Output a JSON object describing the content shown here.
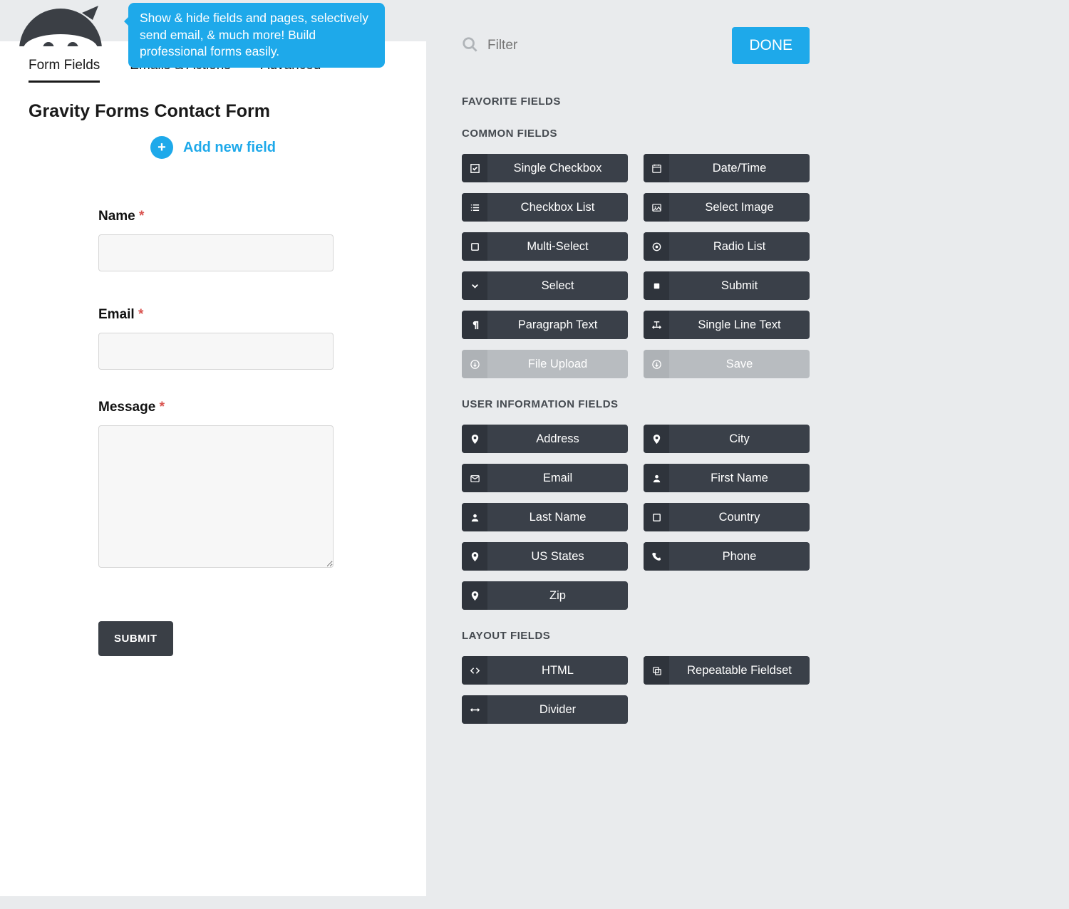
{
  "tooltip": "Show & hide fields and pages, selectively send email, & much more! Build professional forms easily.",
  "tabs": {
    "form_fields": "Form Fields",
    "emails_actions": "Emails & Actions",
    "advanced": "Advanced"
  },
  "form_title": "Gravity Forms Contact Form",
  "add_new_field": "Add new field",
  "fields": {
    "name": {
      "label": "Name",
      "required": true
    },
    "email": {
      "label": "Email",
      "required": true
    },
    "message": {
      "label": "Message",
      "required": true
    }
  },
  "submit_label": "SUBMIT",
  "filter_placeholder": "Filter",
  "done_label": "DONE",
  "sections": {
    "favorite": "FAVORITE FIELDS",
    "common": "COMMON FIELDS",
    "user": "USER INFORMATION FIELDS",
    "layout": "LAYOUT FIELDS"
  },
  "common_fields": [
    {
      "label": "Single Checkbox",
      "icon": "check-square"
    },
    {
      "label": "Date/Time",
      "icon": "calendar"
    },
    {
      "label": "Checkbox List",
      "icon": "list"
    },
    {
      "label": "Select Image",
      "icon": "image"
    },
    {
      "label": "Multi-Select",
      "icon": "square"
    },
    {
      "label": "Radio List",
      "icon": "dot-circle"
    },
    {
      "label": "Select",
      "icon": "chevron-down"
    },
    {
      "label": "Submit",
      "icon": "square-filled"
    },
    {
      "label": "Paragraph Text",
      "icon": "paragraph"
    },
    {
      "label": "Single Line Text",
      "icon": "text-width"
    },
    {
      "label": "File Upload",
      "icon": "circle-arrow",
      "disabled": true
    },
    {
      "label": "Save",
      "icon": "circle-arrow",
      "disabled": true
    }
  ],
  "user_fields": [
    {
      "label": "Address",
      "icon": "map-marker"
    },
    {
      "label": "City",
      "icon": "map-marker"
    },
    {
      "label": "Email",
      "icon": "envelope"
    },
    {
      "label": "First Name",
      "icon": "user"
    },
    {
      "label": "Last Name",
      "icon": "user"
    },
    {
      "label": "Country",
      "icon": "square"
    },
    {
      "label": "US States",
      "icon": "map-marker"
    },
    {
      "label": "Phone",
      "icon": "phone"
    },
    {
      "label": "Zip",
      "icon": "map-marker"
    }
  ],
  "layout_fields": [
    {
      "label": "HTML",
      "icon": "code"
    },
    {
      "label": "Repeatable Fieldset",
      "icon": "copy"
    },
    {
      "label": "Divider",
      "icon": "arrows-h"
    }
  ]
}
